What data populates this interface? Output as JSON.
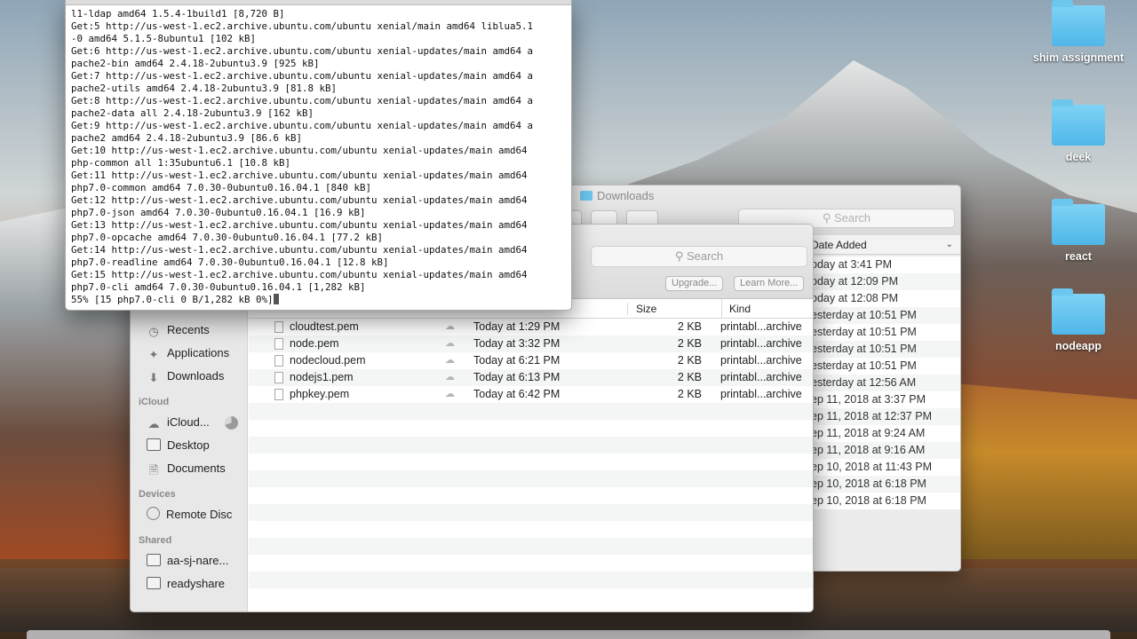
{
  "desktop": {
    "icons": [
      {
        "label": "shim assignment"
      },
      {
        "label": "deek"
      },
      {
        "label": "react"
      },
      {
        "label": "nodeapp"
      }
    ]
  },
  "finder_back": {
    "title": "Downloads",
    "search_placeholder": "Search",
    "column_header": "Date Added",
    "dates": [
      "oday at 3:41 PM",
      "oday at 12:09 PM",
      "oday at 12:08 PM",
      "esterday at 10:51 PM",
      "esterday at 10:51 PM",
      "esterday at 10:51 PM",
      "esterday at 10:51 PM",
      "esterday at 12:56 AM",
      "ep 11, 2018 at 3:37 PM",
      "ep 11, 2018 at 12:37 PM",
      "ep 11, 2018 at 9:24 AM",
      "ep 11, 2018 at 9:16 AM",
      "ep 10, 2018 at 11:43 PM",
      "ep 10, 2018 at 6:18 PM",
      "ep 10, 2018 at 6:18 PM"
    ]
  },
  "finder_front": {
    "search_placeholder": "Search",
    "upgrade_label": "Upgrade...",
    "learn_more_label": "Learn More...",
    "sidebar": {
      "recents": "Recents",
      "applications": "Applications",
      "downloads": "Downloads",
      "icloud_head": "iCloud",
      "icloud_drive": "iCloud...",
      "desktop": "Desktop",
      "documents": "Documents",
      "devices_head": "Devices",
      "remote_disc": "Remote Disc",
      "shared_head": "Shared",
      "shared1": "aa-sj-nare...",
      "shared2": "readyshare"
    },
    "columns": {
      "size": "Size",
      "kind": "Kind"
    },
    "files": [
      {
        "name": "cloudtest.pem",
        "date": "Today at 1:29 PM",
        "size": "2 KB",
        "kind": "printabl...archive"
      },
      {
        "name": "node.pem",
        "date": "Today at 3:32 PM",
        "size": "2 KB",
        "kind": "printabl...archive"
      },
      {
        "name": "nodecloud.pem",
        "date": "Today at 6:21 PM",
        "size": "2 KB",
        "kind": "printabl...archive"
      },
      {
        "name": "nodejs1.pem",
        "date": "Today at 6:13 PM",
        "size": "2 KB",
        "kind": "printabl...archive"
      },
      {
        "name": "phpkey.pem",
        "date": "Today at 6:42 PM",
        "size": "2 KB",
        "kind": "printabl...archive"
      }
    ]
  },
  "terminal": {
    "lines": [
      "l1-ldap amd64 1.5.4-1build1 [8,720 B]",
      "Get:5 http://us-west-1.ec2.archive.ubuntu.com/ubuntu xenial/main amd64 liblua5.1",
      "-0 amd64 5.1.5-8ubuntu1 [102 kB]",
      "Get:6 http://us-west-1.ec2.archive.ubuntu.com/ubuntu xenial-updates/main amd64 a",
      "pache2-bin amd64 2.4.18-2ubuntu3.9 [925 kB]",
      "Get:7 http://us-west-1.ec2.archive.ubuntu.com/ubuntu xenial-updates/main amd64 a",
      "pache2-utils amd64 2.4.18-2ubuntu3.9 [81.8 kB]",
      "Get:8 http://us-west-1.ec2.archive.ubuntu.com/ubuntu xenial-updates/main amd64 a",
      "pache2-data all 2.4.18-2ubuntu3.9 [162 kB]",
      "Get:9 http://us-west-1.ec2.archive.ubuntu.com/ubuntu xenial-updates/main amd64 a",
      "pache2 amd64 2.4.18-2ubuntu3.9 [86.6 kB]",
      "Get:10 http://us-west-1.ec2.archive.ubuntu.com/ubuntu xenial-updates/main amd64",
      "php-common all 1:35ubuntu6.1 [10.8 kB]",
      "Get:11 http://us-west-1.ec2.archive.ubuntu.com/ubuntu xenial-updates/main amd64",
      "php7.0-common amd64 7.0.30-0ubuntu0.16.04.1 [840 kB]",
      "Get:12 http://us-west-1.ec2.archive.ubuntu.com/ubuntu xenial-updates/main amd64",
      "php7.0-json amd64 7.0.30-0ubuntu0.16.04.1 [16.9 kB]",
      "Get:13 http://us-west-1.ec2.archive.ubuntu.com/ubuntu xenial-updates/main amd64",
      "php7.0-opcache amd64 7.0.30-0ubuntu0.16.04.1 [77.2 kB]",
      "Get:14 http://us-west-1.ec2.archive.ubuntu.com/ubuntu xenial-updates/main amd64",
      "php7.0-readline amd64 7.0.30-0ubuntu0.16.04.1 [12.8 kB]",
      "Get:15 http://us-west-1.ec2.archive.ubuntu.com/ubuntu xenial-updates/main amd64",
      "php7.0-cli amd64 7.0.30-0ubuntu0.16.04.1 [1,282 kB]",
      "55% [15 php7.0-cli 0 B/1,282 kB 0%]"
    ]
  }
}
